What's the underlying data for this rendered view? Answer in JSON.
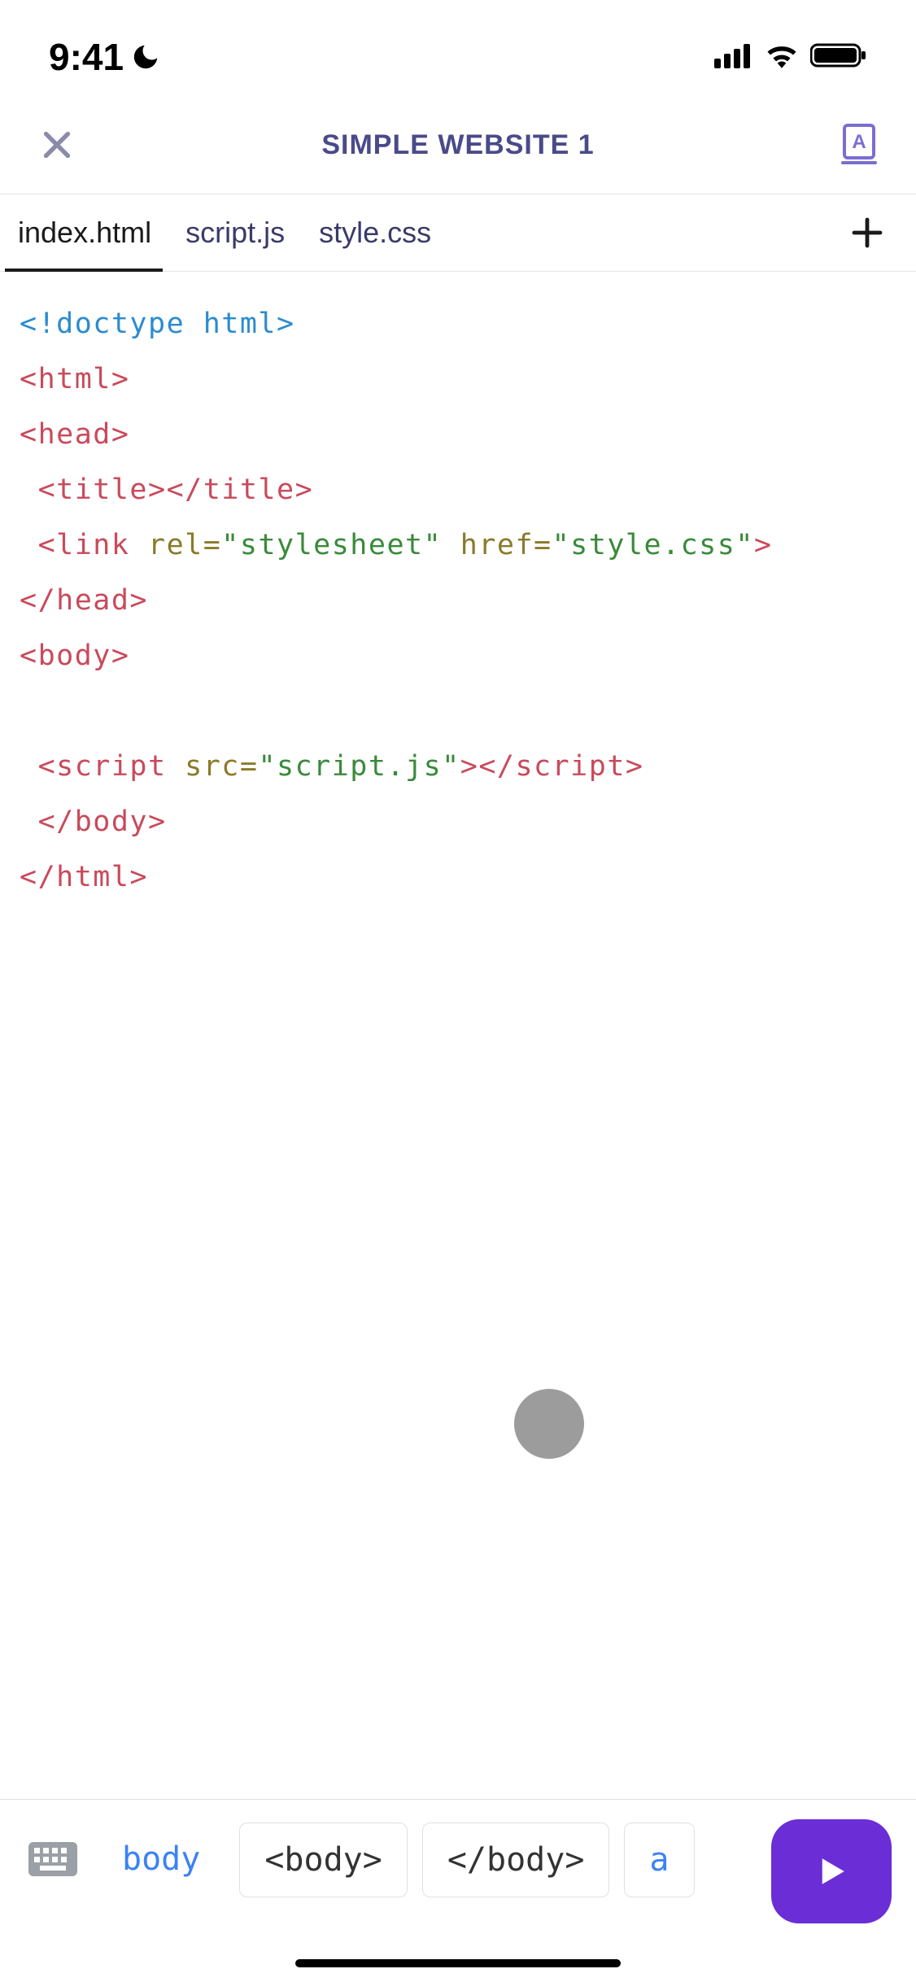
{
  "status": {
    "time": "9:41"
  },
  "header": {
    "title": "SIMPLE WEBSITE 1"
  },
  "tabs": [
    {
      "label": "index.html"
    },
    {
      "label": "script.js"
    },
    {
      "label": "style.css"
    }
  ],
  "code": {
    "doctype": "<!doctype html>",
    "html_open": "<html>",
    "head_open": "<head>",
    "indent": " ",
    "title_open": "<title>",
    "title_close": "</title>",
    "link_open": "<link",
    "link_attr1_name": " rel=",
    "link_attr1_val": "\"stylesheet\"",
    "link_attr2_name": " href=",
    "link_attr2_val": "\"style.css\"",
    "link_close": ">",
    "head_close": "</head>",
    "body_open": "<body>",
    "script_open": "<script",
    "script_attr_name": " src=",
    "script_attr_val": "\"script.js\"",
    "script_mid": ">",
    "script_close_tag": "</script>",
    "body_close": "</body>",
    "html_close": "</html>"
  },
  "snippets": {
    "word": "body",
    "open": "<body>",
    "close": "</body>",
    "partial": "a"
  }
}
